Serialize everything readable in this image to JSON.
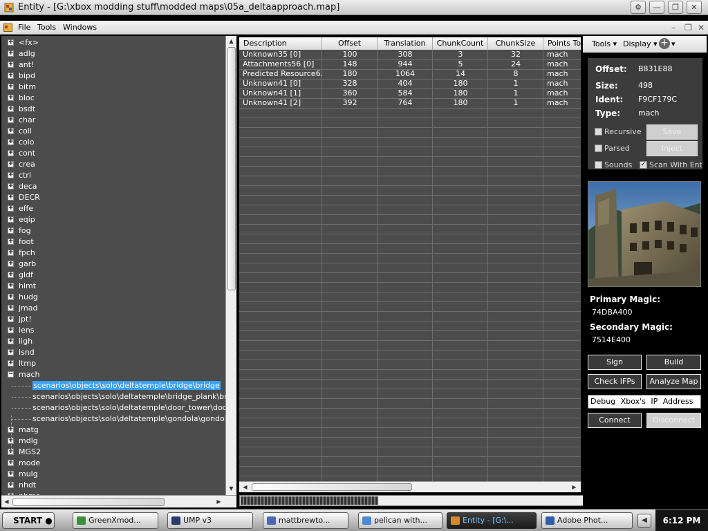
{
  "window": {
    "title": "Entity - [G:\\xbox modding stuff\\modded maps\\05a_deltaapproach.map]"
  },
  "menu": {
    "file": "File",
    "tools": "Tools",
    "windows": "Windows"
  },
  "tree": {
    "nodes_before": [
      "<fx>",
      "adlg",
      "ant!",
      "bipd",
      "bitm",
      "bloc",
      "bsdt",
      "char",
      "coll",
      "colo",
      "cont",
      "crea",
      "ctrl",
      "deca",
      "DECR",
      "effe",
      "eqip",
      "fog",
      "foot",
      "fpch",
      "garb",
      "gldf",
      "hlmt",
      "hudg",
      "jmad",
      "jpt!",
      "lens",
      "ligh",
      "lsnd",
      "ltmp"
    ],
    "expanded_node": "mach",
    "children": [
      "scenarios\\objects\\solo\\deltatemple\\bridge\\bridge",
      "scenarios\\objects\\solo\\deltatemple\\bridge_plank\\bridge_p",
      "scenarios\\objects\\solo\\deltatemple\\door_tower\\door_towe",
      "scenarios\\objects\\solo\\deltatemple\\gondola\\gondola_laun"
    ],
    "nodes_after": [
      "matg",
      "mdlg",
      "MGS2",
      "mode",
      "mulg",
      "nhdt",
      "phmo"
    ]
  },
  "grid": {
    "columns": [
      "Description",
      "Offset",
      "Translation",
      "ChunkCount",
      "ChunkSize",
      "Points To"
    ],
    "rows": [
      [
        "Unknown35 [0]",
        "100",
        "308",
        "3",
        "32",
        "mach"
      ],
      [
        "Attachments56 [0]",
        "148",
        "944",
        "5",
        "24",
        "mach"
      ],
      [
        "Predicted Resource6...",
        "180",
        "1064",
        "14",
        "8",
        "mach"
      ],
      [
        "Unknown41 [0]",
        "328",
        "404",
        "180",
        "1",
        "mach"
      ],
      [
        "Unknown41 [1]",
        "360",
        "584",
        "180",
        "1",
        "mach"
      ],
      [
        "Unknown41 [2]",
        "392",
        "764",
        "180",
        "1",
        "mach"
      ]
    ]
  },
  "panel": {
    "toolbar": {
      "tools": "Tools",
      "display": "Display"
    },
    "info": {
      "offset_label": "Offset:",
      "offset": "B831E88",
      "size_label": "Size:",
      "size": "498",
      "ident_label": "Ident:",
      "ident": "F9CF179C",
      "type_label": "Type:",
      "type": "mach"
    },
    "checks": {
      "recursive": "Recursive",
      "parsed": "Parsed",
      "sounds": "Sounds",
      "scan_with_ent": "Scan With Ent"
    },
    "buttons": {
      "save": "Save",
      "inject": "Inject",
      "sign": "Sign",
      "build": "Build",
      "check_ifps": "Check IFPs",
      "analyze_map": "Analyze Map",
      "connect": "Connect",
      "disconnect": "Disconnect"
    },
    "primary_magic_label": "Primary Magic:",
    "primary_magic": "74DBA400",
    "secondary_magic_label": "Secondary Magic:",
    "secondary_magic": "7514E400",
    "ip_field": "Debug Xbox's IP Address"
  },
  "taskbar": {
    "start": "START",
    "tasks": [
      {
        "label": "GreenXmod...",
        "color": "#3a8f3a"
      },
      {
        "label": "UMP v3",
        "color": "#2a3a6a"
      },
      {
        "label": "mattbrewto...",
        "color": "#4a6ab0"
      },
      {
        "label": "pelican with...",
        "color": "#4a8ad0"
      },
      {
        "label": "Entity - [G:\\...",
        "color": "#d08a30"
      },
      {
        "label": "Adobe Phot...",
        "color": "#2d5ea8"
      }
    ],
    "clock": "6:12 PM"
  }
}
